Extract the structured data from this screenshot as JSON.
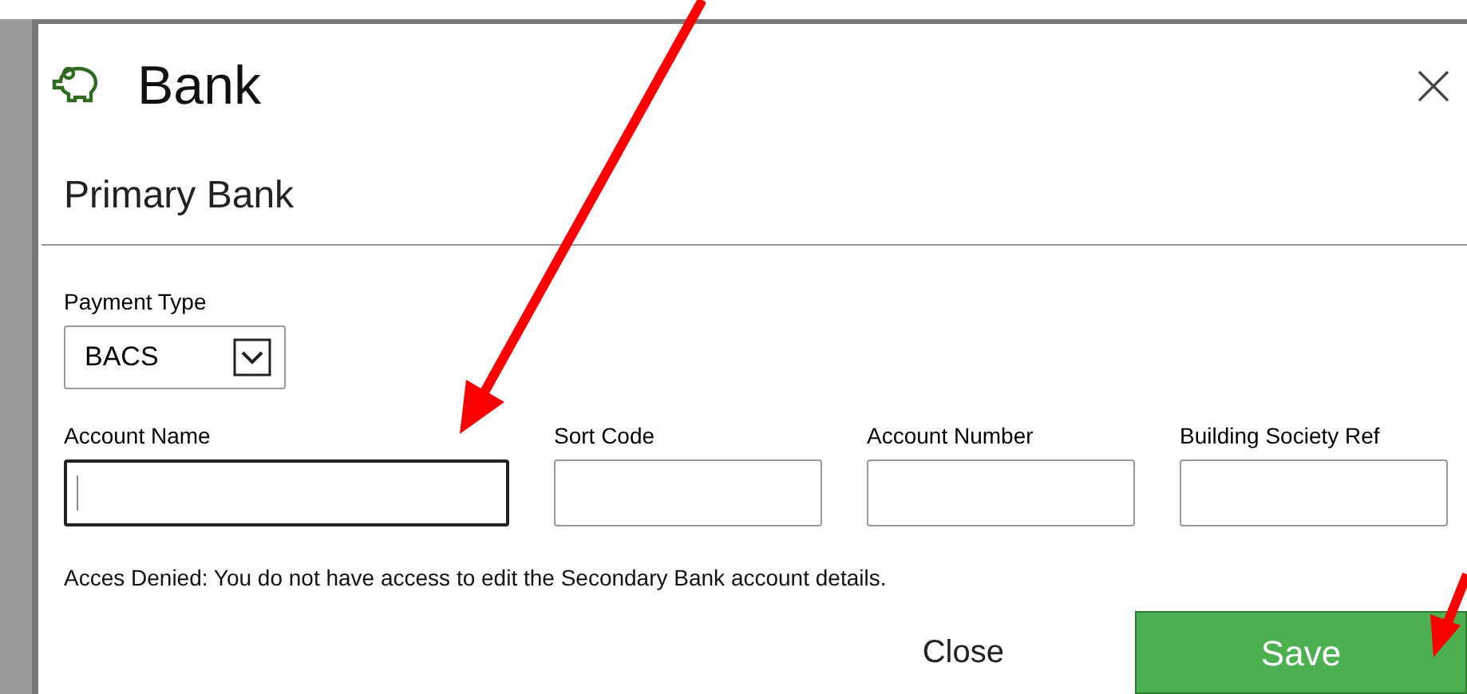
{
  "dialog": {
    "title": "Bank",
    "section": "Primary Bank"
  },
  "payment_type": {
    "label": "Payment Type",
    "value": "BACS"
  },
  "fields": [
    {
      "label": "Account Name",
      "focused": true
    },
    {
      "label": "Sort Code",
      "focused": false
    },
    {
      "label": "Account Number",
      "focused": false
    },
    {
      "label": "Building Society Ref",
      "focused": false
    }
  ],
  "message": "Acces Denied: You do not have access to edit the Secondary Bank account details.",
  "buttons": [
    {
      "label": "Close",
      "kind": "plain"
    },
    {
      "label": "Save",
      "kind": "primary"
    }
  ]
}
